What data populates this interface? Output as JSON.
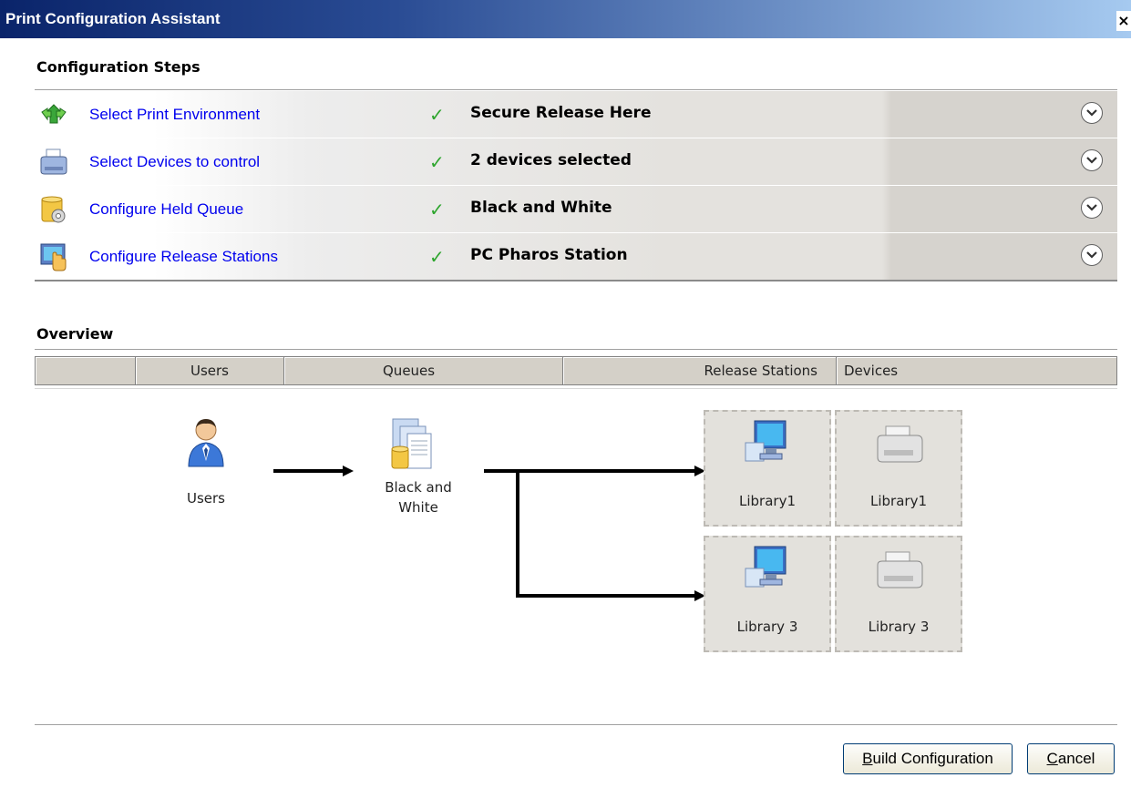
{
  "window": {
    "title": "Print Configuration Assistant",
    "close_glyph": "×"
  },
  "steps": {
    "title": "Configuration Steps",
    "items": [
      {
        "label": "Select Print Environment",
        "value": "Secure Release Here",
        "icon": "environment-arrows-icon"
      },
      {
        "label": "Select Devices to control",
        "value": "2 devices selected",
        "icon": "printer-icon"
      },
      {
        "label": "Configure Held Queue",
        "value": "Black and White",
        "icon": "queue-gear-icon"
      },
      {
        "label": "Configure Release Stations",
        "value": "PC Pharos Station",
        "icon": "release-station-icon"
      }
    ],
    "check_glyph": "✓"
  },
  "overview": {
    "title": "Overview",
    "columns": [
      "",
      "Users",
      "Queues",
      "Release Stations",
      "Devices"
    ],
    "users_label": "Users",
    "queue_label_line1": "Black and",
    "queue_label_line2": "White",
    "stations": [
      {
        "station": "Library1",
        "device": "Library1"
      },
      {
        "station": "Library 3",
        "device": "Library 3"
      }
    ]
  },
  "buttons": {
    "build_prefix": "B",
    "build_rest": "uild Configuration",
    "cancel_prefix": "C",
    "cancel_rest": "ancel"
  },
  "colors": {
    "link": "#0000ee",
    "check": "#2ea52e",
    "title_bar": "#0a246a"
  }
}
